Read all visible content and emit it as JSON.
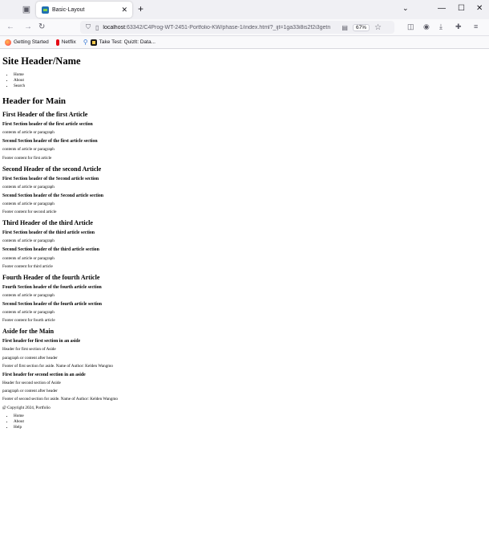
{
  "browser": {
    "tab": {
      "title": "Basic-Layout"
    },
    "url": {
      "host": "localhost",
      "path": ":63342/C4Prog-WT-2451-Portfolio-KW/phase-1/index.html?_ijt=1ga33i8is2f2i3getn"
    },
    "zoom": "67%",
    "bookmarks": [
      {
        "label": "Getting Started",
        "icon": "firefox-icon"
      },
      {
        "label": "Netflix",
        "icon": "netflix-icon"
      },
      {
        "label": "Take Test: Quizlt: Data...",
        "icon": "quiz-icon"
      }
    ]
  },
  "page": {
    "site_header": "Site Header/Name",
    "nav": [
      "Home",
      "About",
      "Search"
    ],
    "main_header": "Header for Main",
    "articles": [
      {
        "title": "First Header of the first Article",
        "sections": [
          {
            "header": "First Section header of the first article section",
            "content": "contents of article or paragraph"
          },
          {
            "header": "Second Section header of the first article section",
            "content": "contents of article or paragraph"
          }
        ],
        "footer": "Footer content for first article"
      },
      {
        "title": "Second Header of the second Article",
        "sections": [
          {
            "header": "First Section header of the Second article section",
            "content": "contents of article or paragraph"
          },
          {
            "header": "Second Section header of the Second article section",
            "content": "contents of article or paragraph"
          }
        ],
        "footer": "Footer content for second article"
      },
      {
        "title": "Third Header of the third Article",
        "sections": [
          {
            "header": "First Section header of the third article section",
            "content": "contents of article or paragraph"
          },
          {
            "header": "Second Section header of the third article section",
            "content": "contents of article or paragraph"
          }
        ],
        "footer": "Footer content for third article"
      },
      {
        "title": "Fourth Header of the fourth Article",
        "sections": [
          {
            "header": "Fourth Section header of the fourth article section",
            "content": "contents of article or paragraph"
          },
          {
            "header": "Second Section header of the fourth article section",
            "content": "contents of article or paragraph"
          }
        ],
        "footer": "Footer content for fourth article"
      }
    ],
    "aside": {
      "title": "Aside for the Main",
      "sections": [
        {
          "header": "First header for first section in an aside",
          "sub": "Header for first section of Aside",
          "para": "paragraph or content after header",
          "footer": "Footer of first section for aside. Name of Author: Kelden Wangmo"
        },
        {
          "header": "First header for second section in an aside",
          "sub": "Header for second section of Aside",
          "para": "paragraph or content after header",
          "footer": "Footer of second section for aside. Name of Author: Kelden Wangmo"
        }
      ]
    },
    "copyright": "@ Copyright 2024, Portfolio",
    "footer_nav": [
      "Home",
      "About",
      "Help"
    ]
  }
}
